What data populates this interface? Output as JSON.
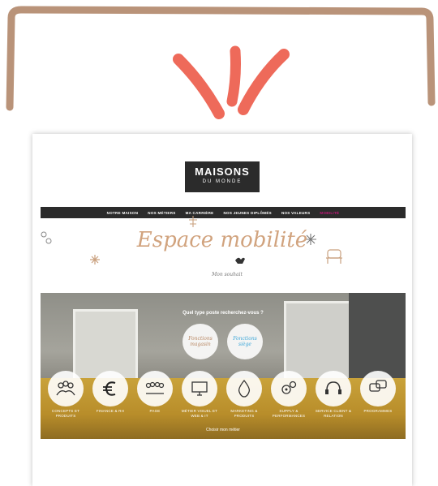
{
  "brand": {
    "logo_main": "MAISONS",
    "logo_sub": "DU MONDE",
    "tagline": "",
    "accent": "#c2177a",
    "frame_color": "#b99379",
    "burst_color": "#ee6a5a"
  },
  "nav": {
    "items": [
      {
        "label": "NOTRE MAISON"
      },
      {
        "label": "NOS MÉTIERS"
      },
      {
        "label": "MA CARRIÈRE"
      },
      {
        "label": "NOS JEUNES DIPLÔMÉS"
      },
      {
        "label": "NOS VALEURS"
      },
      {
        "label": "MOBILITÉ"
      }
    ]
  },
  "hero": {
    "title": "Espace mobilité",
    "subtitle": "Mon souhait"
  },
  "photo": {
    "question": "Quel type poste recherchez-vous ?",
    "option_a": "Fonctions magasin",
    "option_b": "Fonctions siège",
    "categories": [
      {
        "label": "CONCEPTS ET PRODUITS",
        "icon": "team-icon"
      },
      {
        "label": "FINANCE & RH",
        "icon": "euro-icon"
      },
      {
        "label": "PAGE",
        "icon": "group-icon"
      },
      {
        "label": "MÉTIER VISUEL ET WEB & IT",
        "icon": "screen-icon"
      },
      {
        "label": "MARKETING & PRODUITS",
        "icon": "drop-icon"
      },
      {
        "label": "SUPPLY & PERFORMANCES",
        "icon": "gears-icon"
      },
      {
        "label": "SERVICE CLIENT & RELATION",
        "icon": "headset-icon"
      },
      {
        "label": "PROGRAMMES",
        "icon": "chat-icon"
      }
    ],
    "footer_note": "Choisir mon métier"
  }
}
